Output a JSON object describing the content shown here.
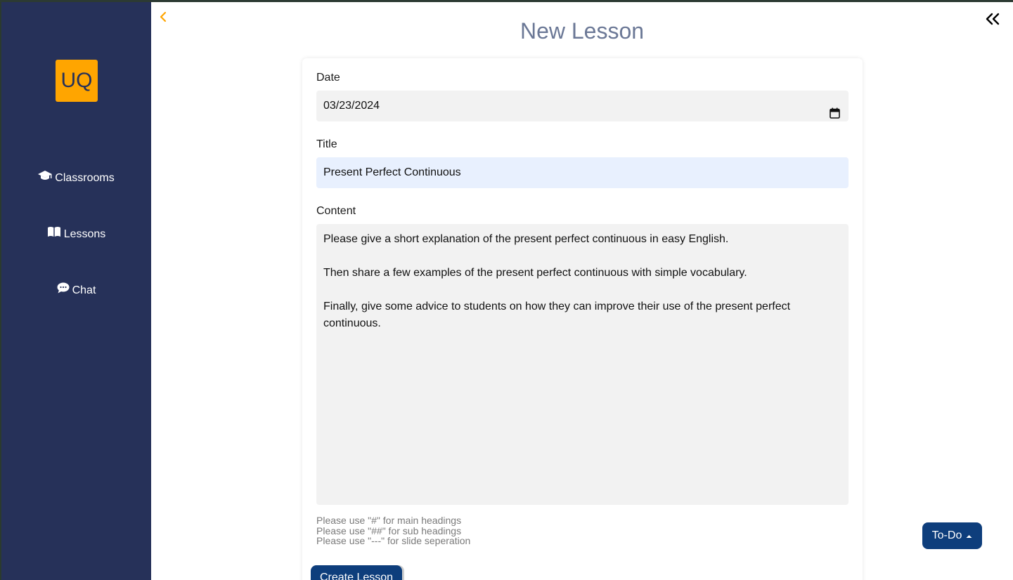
{
  "sidebar": {
    "logo_text": "UQ",
    "items": [
      {
        "label": "Classrooms",
        "icon": "graduation-cap-icon"
      },
      {
        "label": "Lessons",
        "icon": "book-icon"
      },
      {
        "label": "Chat",
        "icon": "chat-bubble-icon"
      }
    ]
  },
  "header": {
    "title": "New Lesson"
  },
  "form": {
    "date_label": "Date",
    "date_value": "03/23/2024",
    "title_label": "Title",
    "title_value": "Present Perfect Continuous",
    "content_label": "Content",
    "content_value": "Please give a short explanation of the present perfect continuous in easy English.\n\nThen share a few examples of the present perfect continuous with simple vocabulary.\n\nFinally, give some advice to students on how they can improve their use of the present perfect\ncontinuous.",
    "hints": [
      "Please use \"#\" for main headings",
      "Please use \"##\" for sub headings",
      "Please use \"---\" for slide seperation"
    ],
    "submit_label": "Create Lesson"
  },
  "todo": {
    "label": "To-Do"
  },
  "colors": {
    "sidebar_bg": "#263159",
    "accent": "#ffa500",
    "primary_button": "#0e3e7c",
    "title_text": "#6b7896"
  }
}
